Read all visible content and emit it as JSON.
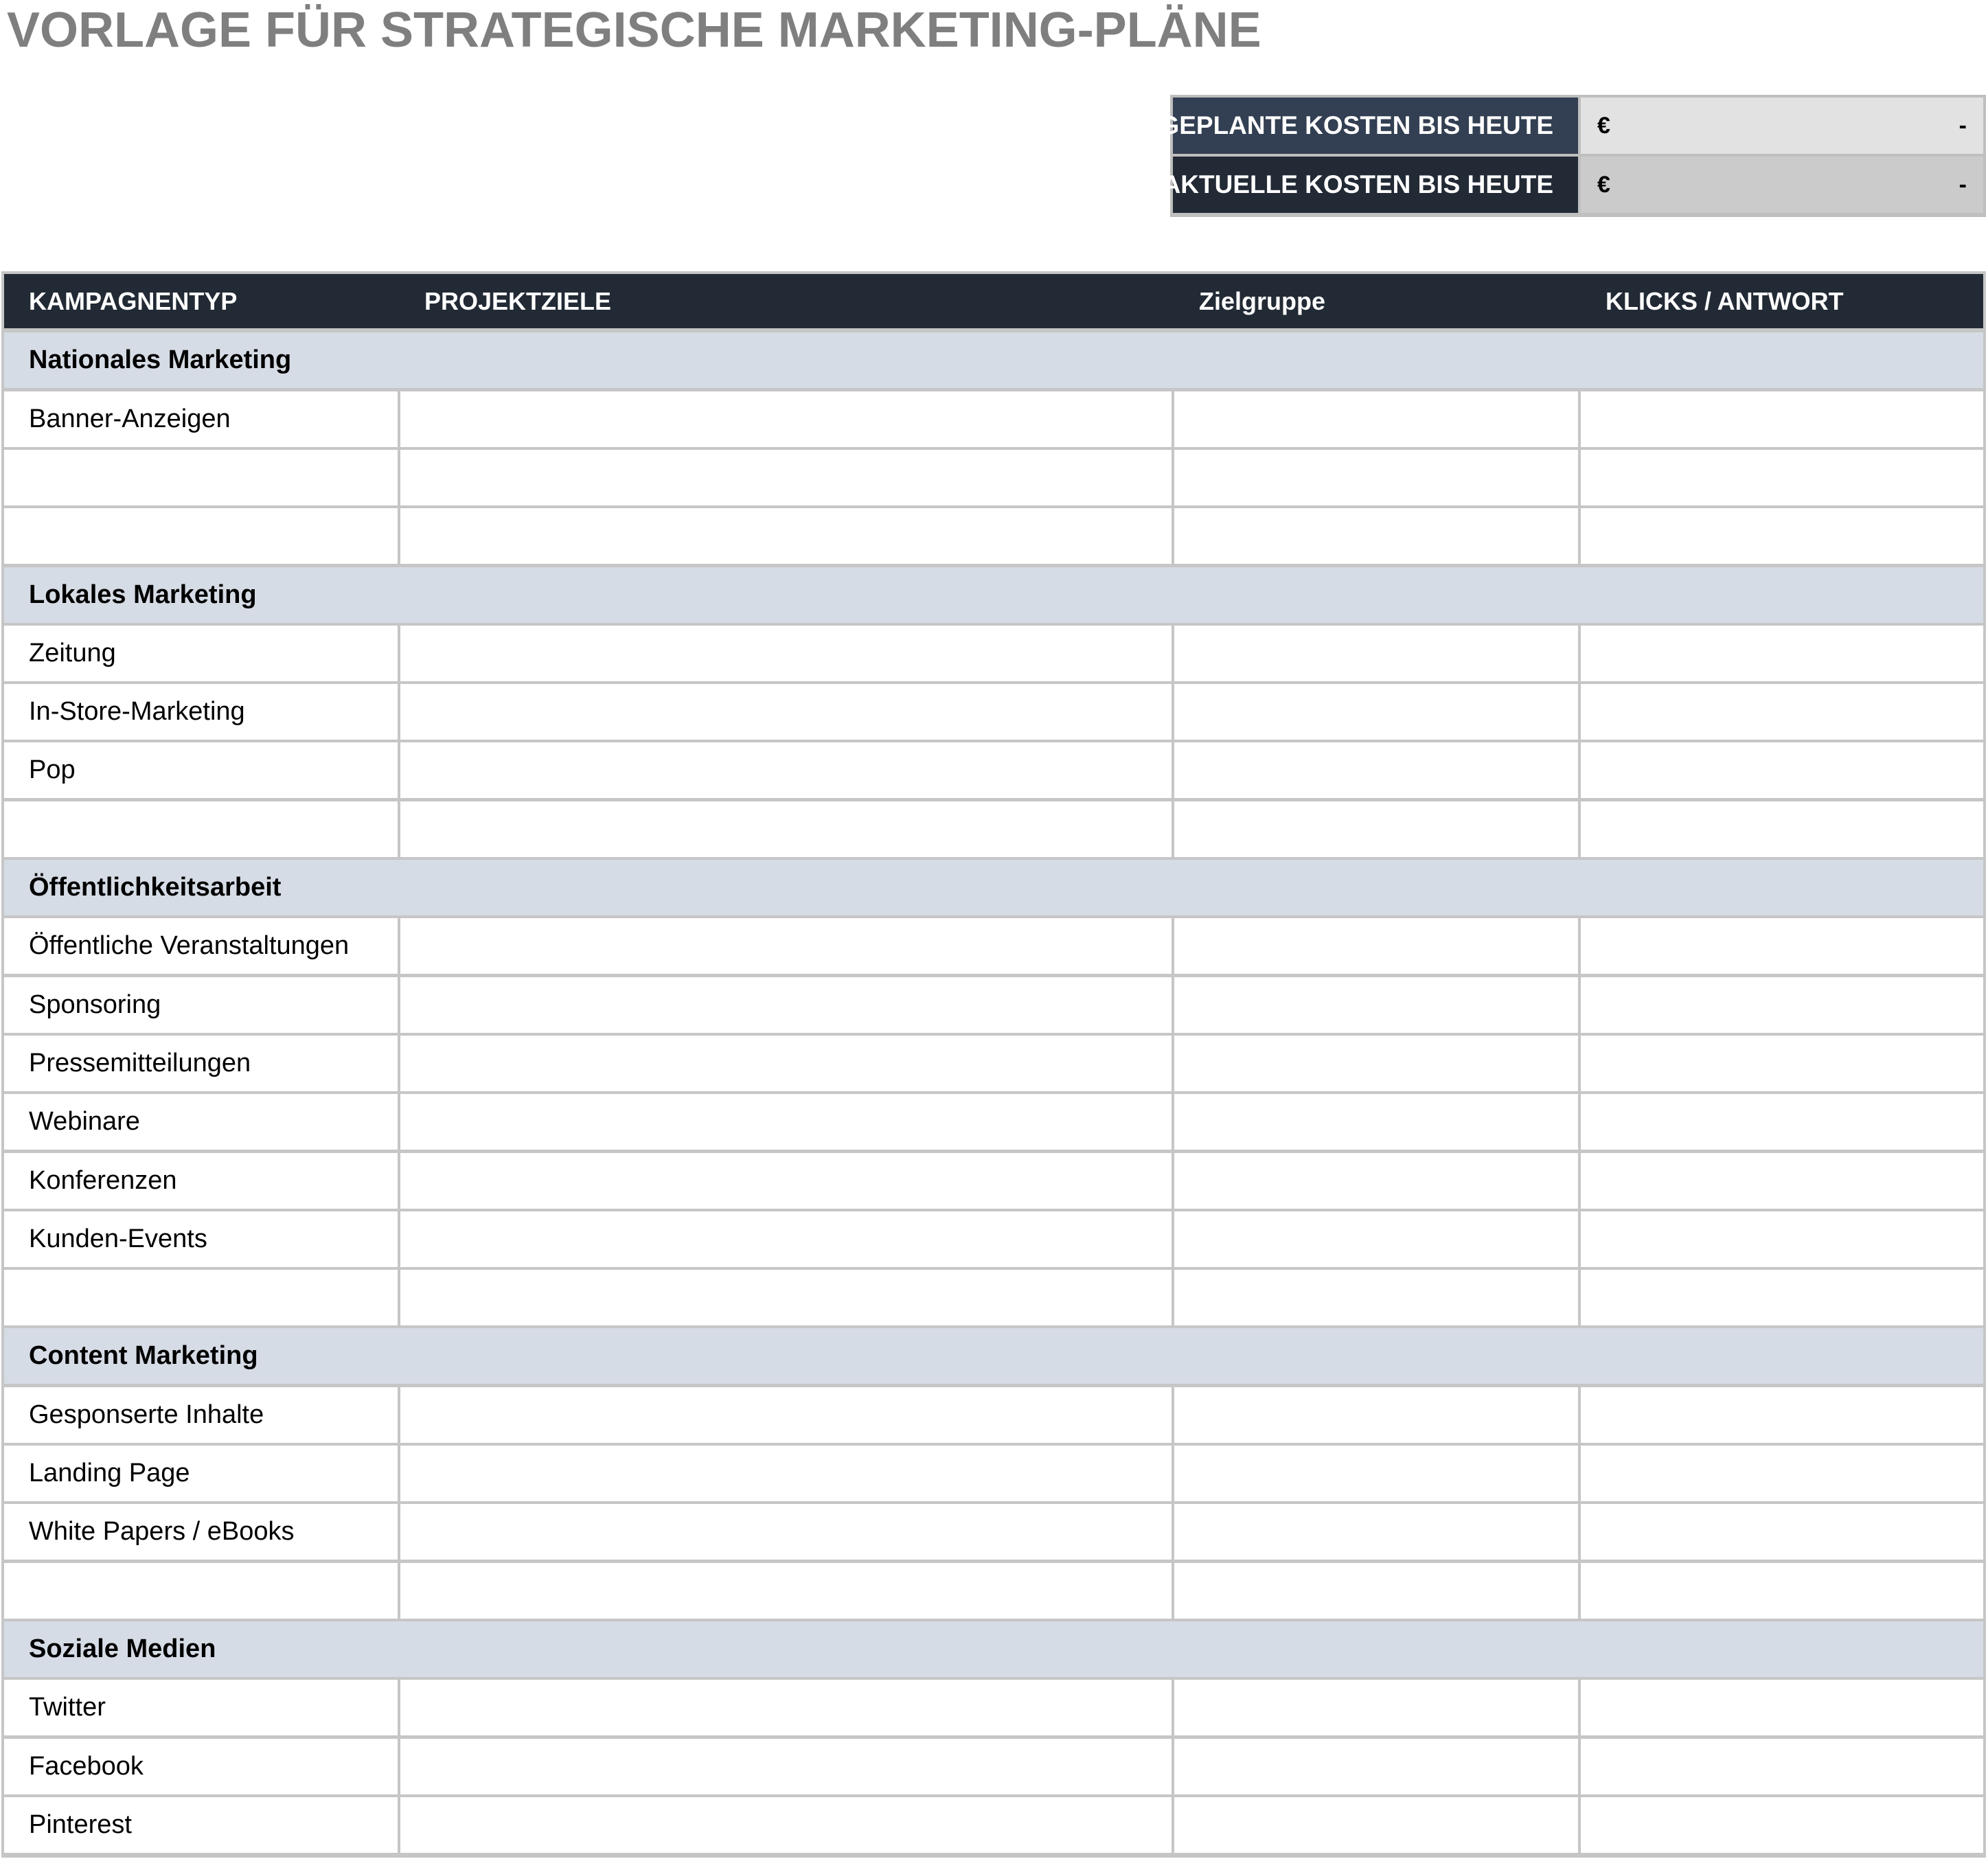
{
  "title": "VORLAGE FÜR STRATEGISCHE MARKETING-PLÄNE",
  "summary": [
    {
      "label": "GEPLANTE KOSTEN BIS HEUTE",
      "currency": "€",
      "value": "-"
    },
    {
      "label": "AKTUELLE KOSTEN BIS HEUTE",
      "currency": "€",
      "value": "-"
    }
  ],
  "columns": [
    "KAMPAGNENTYP",
    "PROJEKTZIELE",
    "Zielgruppe",
    "KLICKS / ANTWORT"
  ],
  "sections": [
    {
      "name": "Nationales Marketing",
      "rows": [
        "Banner-Anzeigen",
        "",
        ""
      ]
    },
    {
      "name": "Lokales Marketing",
      "rows": [
        "Zeitung",
        "In-Store-Marketing",
        "Pop",
        ""
      ]
    },
    {
      "name": "Öffentlichkeitsarbeit",
      "rows": [
        "Öffentliche Veranstaltungen",
        "Sponsoring",
        "Pressemitteilungen",
        "Webinare",
        "Konferenzen",
        "Kunden-Events",
        ""
      ]
    },
    {
      "name": "Content Marketing",
      "rows": [
        "Gesponserte Inhalte",
        "Landing Page",
        "White Papers / eBooks",
        ""
      ]
    },
    {
      "name": "Soziale Medien",
      "rows": [
        "Twitter",
        "Facebook",
        "Pinterest"
      ]
    }
  ],
  "colors": {
    "title": "#7f7f7f",
    "header_bg": "#222a35",
    "summary_label_1": "#333f52",
    "summary_label_2": "#222a35",
    "section_bg": "#d6dce5",
    "grid_line": "#c6c6c6"
  }
}
